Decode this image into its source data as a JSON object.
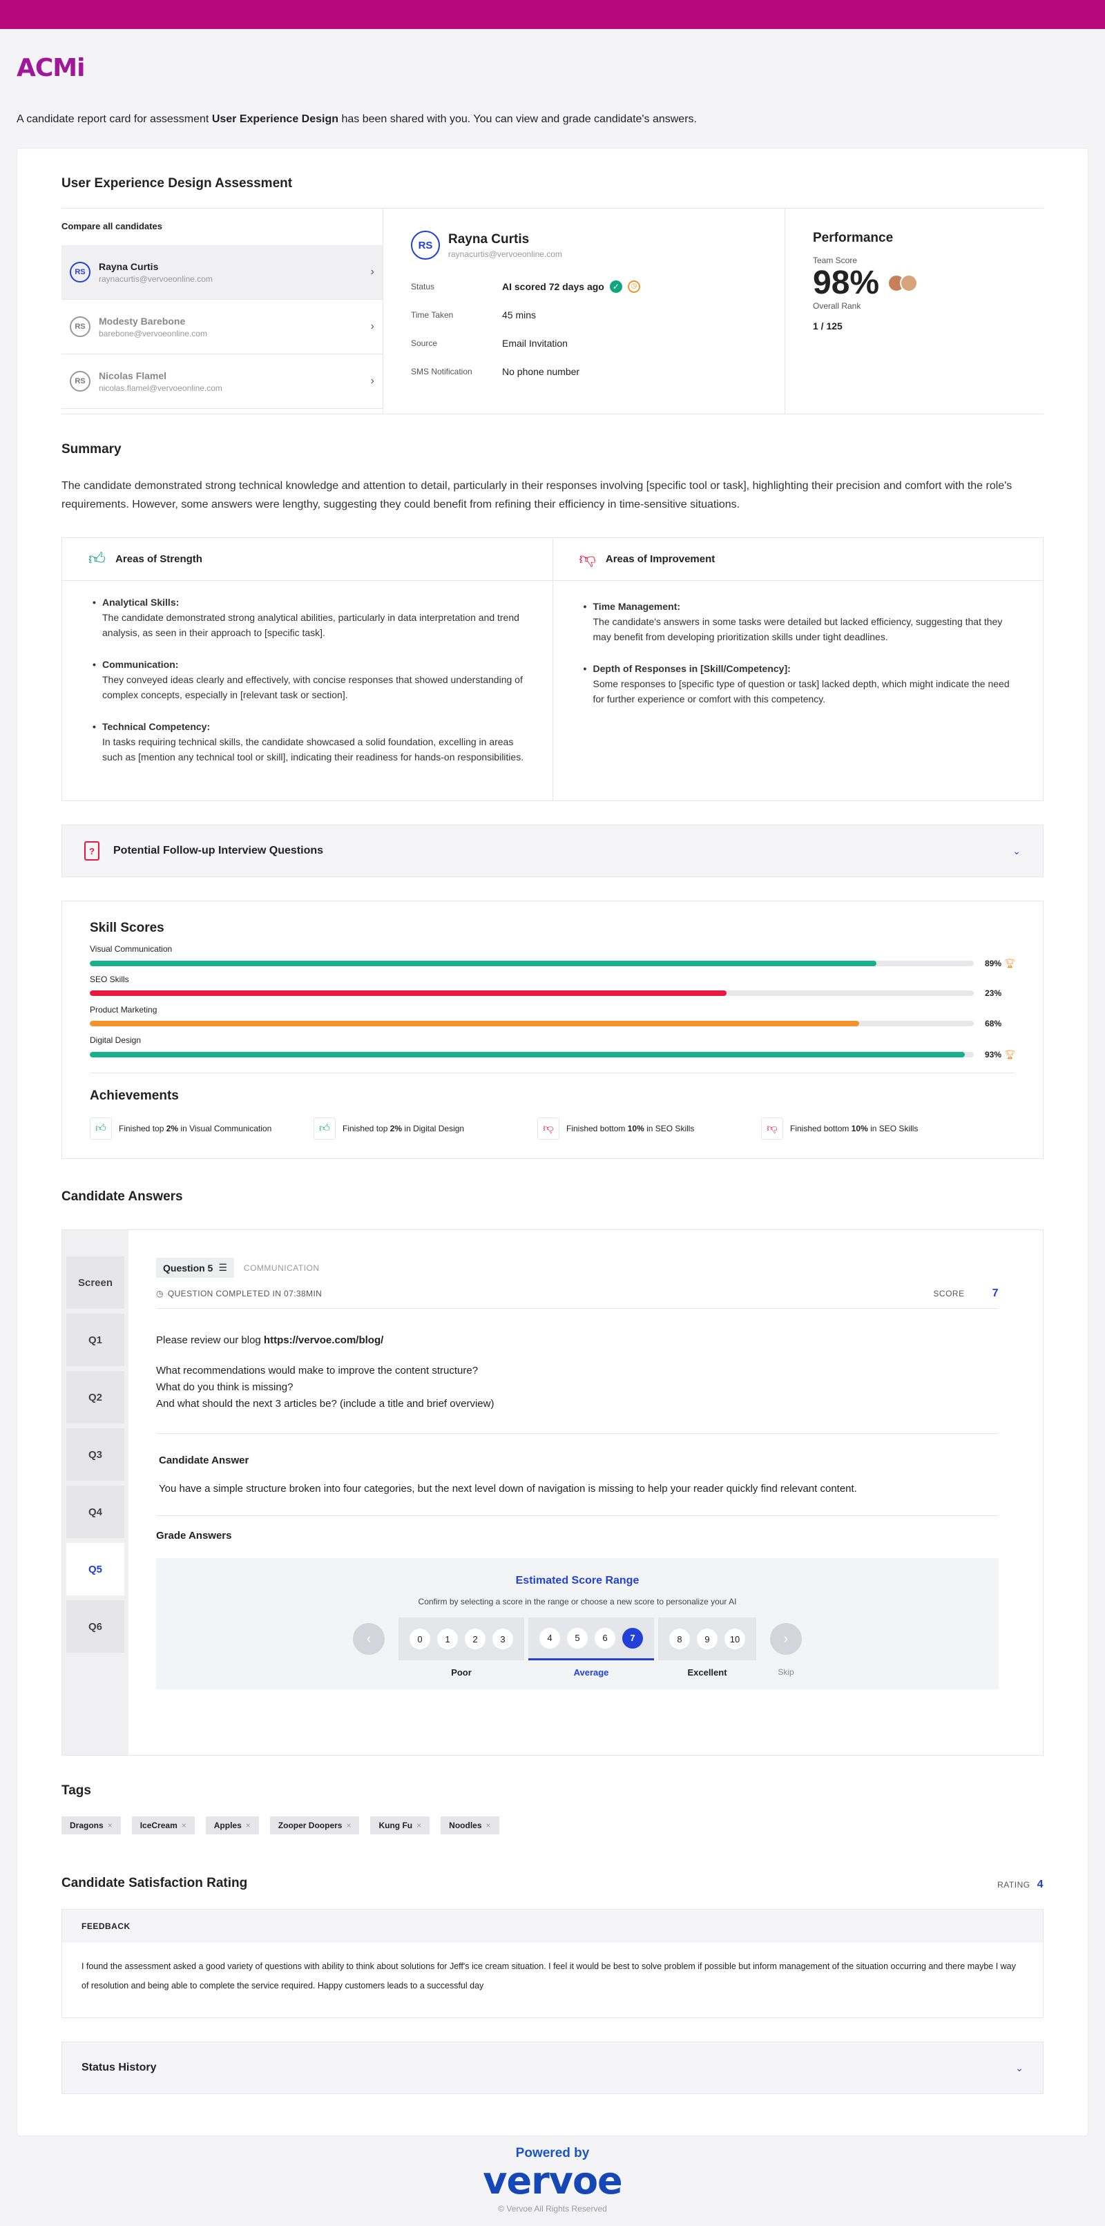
{
  "brand": {
    "logo": "ACMi"
  },
  "intro": {
    "pre": "A candidate report card for assessment ",
    "assessment": "User Experience Design",
    "post": " has been shared with you. You can view and grade candidate's answers."
  },
  "assessment_title": "User Experience Design Assessment",
  "compare_label": "Compare all candidates",
  "candidates": [
    {
      "initials": "RS",
      "name": "Rayna Curtis",
      "email": "raynacurtis@vervoeonline.com"
    },
    {
      "initials": "RS",
      "name": "Modesty Barebone",
      "email": "barebone@vervoeonline.com"
    },
    {
      "initials": "RS",
      "name": "Nicolas Flamel",
      "email": "nicolas.flamel@vervoeonline.com"
    }
  ],
  "detail": {
    "initials": "RS",
    "name": "Rayna Curtis",
    "email": "raynacurtis@vervoeonline.com",
    "rows": [
      {
        "label": "Status",
        "value": "AI scored 72 days ago"
      },
      {
        "label": "Time Taken",
        "value": "45 mins"
      },
      {
        "label": "Source",
        "value": "Email Invitation"
      },
      {
        "label": "SMS Notification",
        "value": "No phone number"
      }
    ]
  },
  "performance": {
    "title": "Performance",
    "team_label": "Team Score",
    "score": "98%",
    "rank_label": "Overall Rank",
    "rank": "1 / 125"
  },
  "summary": {
    "title": "Summary",
    "text": "The candidate demonstrated strong technical knowledge and attention to detail, particularly in their responses involving [specific tool or task], highlighting their precision and comfort with the role's requirements. However, some answers were lengthy, suggesting they could benefit from refining their efficiency in time-sensitive situations."
  },
  "strengths": {
    "title": "Areas of Strength",
    "items": [
      {
        "head": "Analytical Skills:",
        "body": "The candidate demonstrated strong analytical abilities, particularly in data interpretation and trend analysis, as seen in their approach to [specific task]."
      },
      {
        "head": "Communication:",
        "body": "They conveyed ideas clearly and effectively, with concise responses that showed understanding of complex concepts, especially in [relevant task or section]."
      },
      {
        "head": "Technical Competency:",
        "body": "In tasks requiring technical skills, the candidate showcased a solid foundation, excelling in areas such as [mention any technical tool or skill], indicating their readiness for hands-on responsibilities."
      }
    ]
  },
  "improvements": {
    "title": "Areas of Improvement",
    "items": [
      {
        "head": "Time Management:",
        "body": "The candidate's answers in some tasks were detailed but lacked efficiency, suggesting that they may benefit from developing prioritization skills under tight deadlines."
      },
      {
        "head": "Depth of Responses in [Skill/Competency]:",
        "body": "Some responses to [specific type of question or task] lacked depth, which might indicate the need for further experience or comfort with this competency."
      }
    ]
  },
  "followup": {
    "title": "Potential Follow-up Interview Questions",
    "icon": "?"
  },
  "skills": {
    "title": "Skill Scores",
    "items": [
      {
        "name": "Visual Communication",
        "pct": 89,
        "label": "89%",
        "color": "#17b08d",
        "trophy": true
      },
      {
        "name": "SEO Skills",
        "pct": 72,
        "label": "23%",
        "color": "#e8183e",
        "trophy": false
      },
      {
        "name": "Product Marketing",
        "pct": 87,
        "label": "68%",
        "color": "#f4932b",
        "trophy": false
      },
      {
        "name": "Digital Design",
        "pct": 99,
        "label": "93%",
        "color": "#17b08d",
        "trophy": true
      }
    ]
  },
  "achievements": {
    "title": "Achievements",
    "items": [
      {
        "type": "up",
        "pre": "Finished top ",
        "bold": "2%",
        "post": " in Visual Communication"
      },
      {
        "type": "up",
        "pre": "Finished top ",
        "bold": "2%",
        "post": " in Digital Design"
      },
      {
        "type": "down",
        "pre": "Finished bottom ",
        "bold": "10%",
        "post": " in SEO Skills"
      },
      {
        "type": "down",
        "pre": "Finished bottom ",
        "bold": "10%",
        "post": " in SEO Skills"
      }
    ]
  },
  "answers": {
    "title": "Candidate Answers",
    "nav": [
      "Screen",
      "Q1",
      "Q2",
      "Q3",
      "Q4",
      "Q5",
      "Q6"
    ],
    "active_index": 5,
    "question_label": "Question 5",
    "category": "COMMUNICATION",
    "completed": "QUESTION COMPLETED IN 07:38MIN",
    "score_label": "SCORE",
    "score": "7",
    "prompt_pre": "Please review our blog ",
    "prompt_link": "https://vervoe.com/blog/",
    "lines": [
      "What recommendations would make to improve the content structure?",
      "What do you think is missing?",
      "And what should the next 3 articles be? (include a title and brief overview)"
    ],
    "candidate_answer_title": "Candidate Answer",
    "candidate_answer": "You have a simple structure broken into four categories, but the next level down of navigation is missing to help your reader quickly find relevant content.",
    "grade_title": "Grade Answers",
    "range_title": "Estimated Score Range",
    "range_sub": "Confirm by selecting a score in the range or choose a new score to personalize your AI",
    "groups": [
      {
        "label": "Poor",
        "nums": [
          "0",
          "1",
          "2",
          "3"
        ]
      },
      {
        "label": "Average",
        "nums": [
          "4",
          "5",
          "6",
          "7"
        ]
      },
      {
        "label": "Excellent",
        "nums": [
          "8",
          "9",
          "10"
        ]
      }
    ],
    "selected": "7",
    "skip": "Skip",
    "prev_icon": "‹",
    "next_icon": "›"
  },
  "tags": {
    "title": "Tags",
    "items": [
      "Dragons",
      "IceCream",
      "Apples",
      "Zooper Doopers",
      "Kung Fu",
      "Noodles"
    ]
  },
  "satisfaction": {
    "title": "Candidate Satisfaction Rating",
    "rating_label": "RATING",
    "rating": "4",
    "feedback_label": "FEEDBACK",
    "feedback": "I found the assessment asked a good variety of questions with ability to think about solutions for Jeff's ice cream situation. I feel it would be best to solve problem if possible but inform management of the situation occurring and there maybe I way of resolution and being able to complete the service required. Happy customers leads to a successful day"
  },
  "status_history": {
    "title": "Status History"
  },
  "footer": {
    "powered": "Powered by",
    "brand": "vervoe",
    "copy": "© Vervoe  All Rights Reserved"
  }
}
